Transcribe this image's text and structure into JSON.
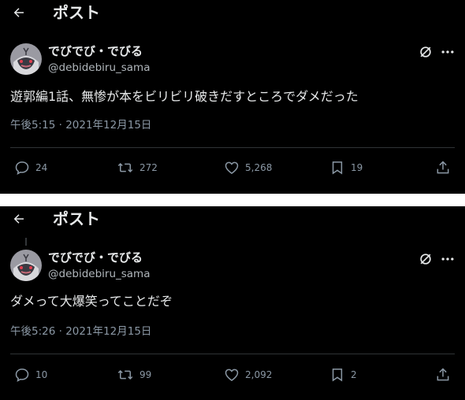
{
  "colors": {
    "background": "#000000",
    "text": "#e7e9ea",
    "muted": "#8b98a5",
    "divider": "#2f3336",
    "separator": "#ffffff"
  },
  "posts": [
    {
      "header_title": "ポスト",
      "author": {
        "name": "でびでび・でびる",
        "handle": "@debidebiru_sama",
        "avatar_icon": "avatar-image"
      },
      "text": "遊郭編1話、無惨が本をビリビリ破きだすところでダメだった",
      "timestamp": "午後5:15 · 2021年12月15日",
      "replies": "24",
      "reposts": "272",
      "likes": "5,268",
      "bookmarks": "19"
    },
    {
      "header_title": "ポスト",
      "author": {
        "name": "でびでび・でびる",
        "handle": "@debidebiru_sama",
        "avatar_icon": "avatar-image"
      },
      "text": "ダメって大爆笑ってことだぞ",
      "timestamp": "午後5:26 · 2021年12月15日",
      "replies": "10",
      "reposts": "99",
      "likes": "2,092",
      "bookmarks": "2"
    }
  ]
}
